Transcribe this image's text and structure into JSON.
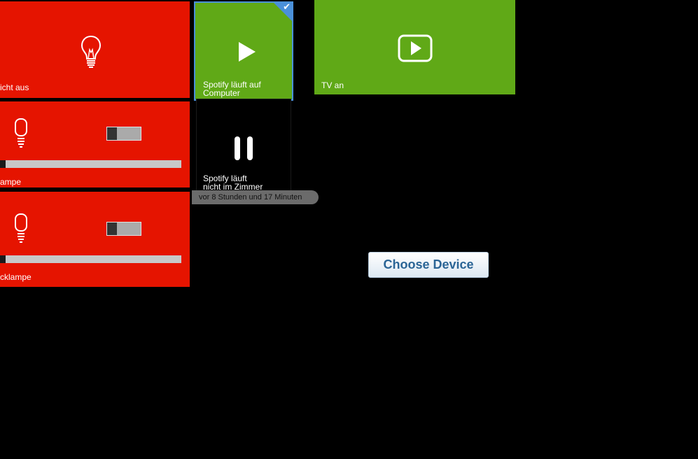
{
  "tiles": {
    "light_off": {
      "label": "icht aus",
      "icon": "lightbulb-icon",
      "color": "#e51400"
    },
    "spotify_computer": {
      "label": "Spotify läuft auf\nComputer",
      "icon": "play-icon",
      "color": "#60a917",
      "selected": true
    },
    "tv_on": {
      "label": "TV an",
      "icon": "play-button-icon",
      "color": "#60a917"
    },
    "lamp_1": {
      "label": "ampe",
      "icon": "bulb-icon",
      "color": "#e51400",
      "dimmer_level": 0.03
    },
    "spotify_room": {
      "label": "Spotify läuft\nnicht im Zimmer",
      "icon": "pause-icon",
      "color": "#000000"
    },
    "lamp_2": {
      "label": "cklampe",
      "icon": "bulb-icon",
      "color": "#e51400",
      "dimmer_level": 0.03
    }
  },
  "timestamp": "vor 8 Stunden und 17 Minuten",
  "choose_device": {
    "label": "Choose Device"
  },
  "colors": {
    "background": "#000000",
    "red_tile": "#e51400",
    "green_tile": "#60a917",
    "selection": "#4a90d9",
    "button_text": "#2b6596"
  }
}
